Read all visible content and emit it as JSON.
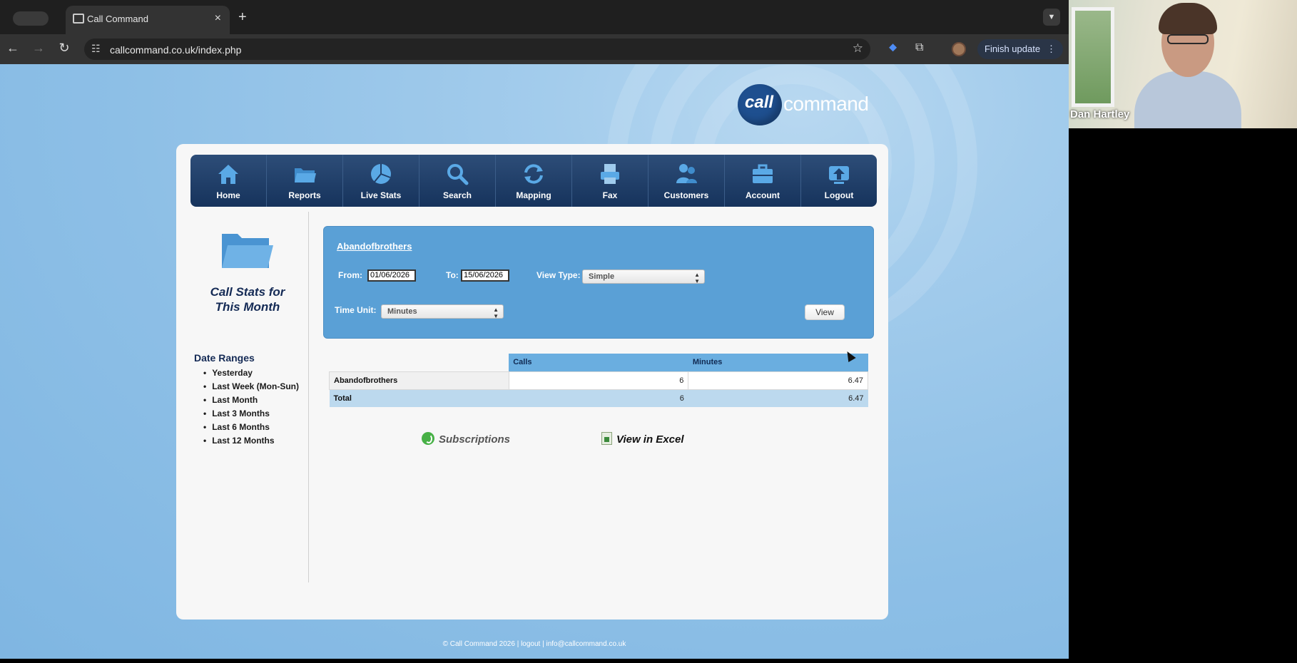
{
  "browser": {
    "tab_title": "Call Command",
    "tab_close": "×",
    "new_tab": "+",
    "url": "callcommand.co.uk/index.php",
    "finish_update": "Finish update",
    "nav_back": "←",
    "nav_forward": "→",
    "nav_reload": "↻"
  },
  "logo": {
    "bubble_text": "call",
    "wordmark": "command"
  },
  "nav": {
    "items": [
      {
        "label": "Home",
        "icon": "home-icon"
      },
      {
        "label": "Reports",
        "icon": "folder-icon"
      },
      {
        "label": "Live Stats",
        "icon": "pie-chart-icon"
      },
      {
        "label": "Search",
        "icon": "search-icon"
      },
      {
        "label": "Mapping",
        "icon": "refresh-icon"
      },
      {
        "label": "Fax",
        "icon": "printer-icon"
      },
      {
        "label": "Customers",
        "icon": "users-icon"
      },
      {
        "label": "Account",
        "icon": "briefcase-icon"
      },
      {
        "label": "Logout",
        "icon": "upload-icon"
      }
    ]
  },
  "sidebar": {
    "title_line1": "Call Stats for",
    "title_line2": "This Month",
    "date_ranges_heading": "Date Ranges",
    "date_ranges": [
      "Yesterday",
      "Last Week (Mon-Sun)",
      "Last Month",
      "Last 3 Months",
      "Last 6 Months",
      "Last 12 Months"
    ]
  },
  "filter": {
    "account_name": "Abandofbrothers",
    "from_label": "From:",
    "from_value": "01/06/2026",
    "to_label": "To:",
    "to_value": "15/06/2026",
    "view_type_label": "View Type:",
    "view_type_value": "Simple",
    "time_unit_label": "Time Unit:",
    "time_unit_value": "Minutes",
    "view_button": "View"
  },
  "stats_table": {
    "columns": [
      "Calls",
      "Minutes"
    ],
    "rows": [
      {
        "label": "Abandofbrothers",
        "calls": "6",
        "minutes": "6.47"
      }
    ],
    "total": {
      "label": "Total",
      "calls": "6",
      "minutes": "6.47"
    }
  },
  "links": {
    "subscriptions": "Subscriptions",
    "view_in_excel": "View in Excel"
  },
  "footer": {
    "text": "© Call Command 2026 | logout | info@callcommand.co.uk"
  },
  "video": {
    "participant_name": "Dan Hartley"
  },
  "colors": {
    "nav_bar": "#1f3f6a",
    "filter_box": "#5aa0d6",
    "table_header": "#6aaee0",
    "page_background": "#8dbfe6"
  }
}
